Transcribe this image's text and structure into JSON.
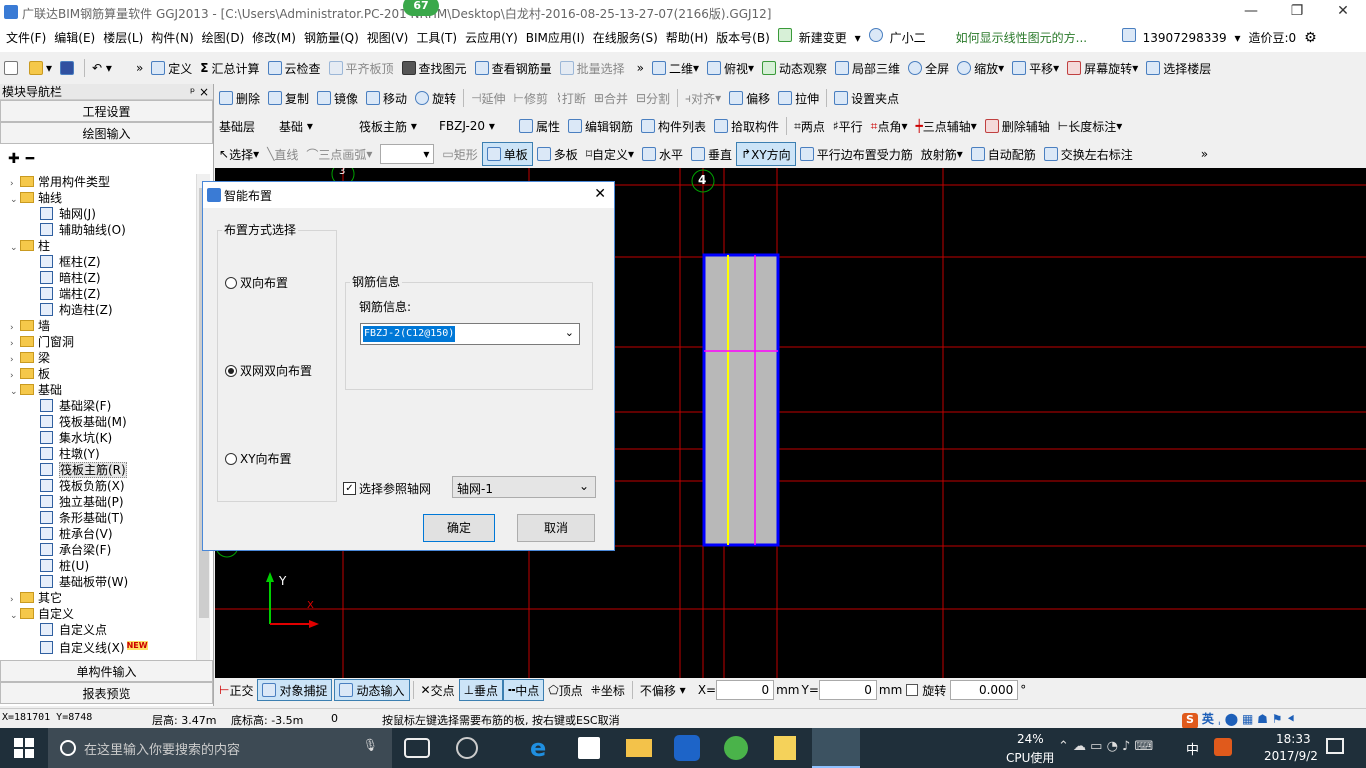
{
  "window": {
    "title": "广联达BIM钢筋算量软件 GGJ2013 - [C:\\Users\\Administrator.PC-201     NRHM\\Desktop\\白龙村-2016-08-25-13-27-07(2166版).GGJ12]",
    "badge": "67",
    "min": "—",
    "restore": "❐",
    "close": "✕"
  },
  "menu": [
    "文件(F)",
    "编辑(E)",
    "楼层(L)",
    "构件(N)",
    "绘图(D)",
    "修改(M)",
    "钢筋量(Q)",
    "视图(V)",
    "工具(T)",
    "云应用(Y)",
    "BIM应用(I)",
    "在线服务(S)",
    "帮助(H)",
    "版本号(B)",
    "新建变更",
    "广小二",
    "如何显示线性图元的方...",
    "13907298339",
    "造价豆:0"
  ],
  "toolbar1": [
    "定义",
    "汇总计算",
    "云检查",
    "平齐板顶",
    "查找图元",
    "查看钢筋量",
    "批量选择",
    "二维",
    "俯视",
    "动态观察",
    "局部三维",
    "全屏",
    "缩放",
    "平移",
    "屏幕旋转",
    "选择楼层"
  ],
  "toolbar2": [
    "删除",
    "复制",
    "镜像",
    "移动",
    "旋转",
    "延伸",
    "修剪",
    "打断",
    "合并",
    "分割",
    "对齐",
    "偏移",
    "拉伸",
    "设置夹点"
  ],
  "toolbar3": [
    "基础层",
    "基础",
    "筏板主筋",
    "FBZJ-20",
    "属性",
    "编辑钢筋",
    "构件列表",
    "拾取构件",
    "两点",
    "平行",
    "点角",
    "三点辅轴",
    "删除辅轴",
    "长度标注"
  ],
  "toolbar4": [
    "选择",
    "直线",
    "三点画弧",
    "矩形",
    "单板",
    "多板",
    "自定义",
    "水平",
    "垂直",
    "XY方向",
    "平行边布置受力筋",
    "放射筋",
    "自动配筋",
    "交换左右标注"
  ],
  "nav": {
    "header": "模块导航栏",
    "pin": "ᵖ ×",
    "project": "工程设置",
    "draw": "绘图输入",
    "single": "单构件输入",
    "report": "报表预览"
  },
  "tree": [
    {
      "label": "常用构件类型",
      "kind": "folder",
      "exp": "›",
      "level": 0
    },
    {
      "label": "轴线",
      "kind": "folder",
      "exp": "⌄",
      "level": 0
    },
    {
      "label": "轴网(J)",
      "kind": "item",
      "level": 1
    },
    {
      "label": "辅助轴线(O)",
      "kind": "item",
      "level": 1
    },
    {
      "label": "柱",
      "kind": "folder",
      "exp": "⌄",
      "level": 0
    },
    {
      "label": "框柱(Z)",
      "kind": "item",
      "level": 1
    },
    {
      "label": "暗柱(Z)",
      "kind": "item",
      "level": 1
    },
    {
      "label": "端柱(Z)",
      "kind": "item",
      "level": 1
    },
    {
      "label": "构造柱(Z)",
      "kind": "item",
      "level": 1
    },
    {
      "label": "墙",
      "kind": "folder",
      "exp": "›",
      "level": 0
    },
    {
      "label": "门窗洞",
      "kind": "folder",
      "exp": "›",
      "level": 0
    },
    {
      "label": "梁",
      "kind": "folder",
      "exp": "›",
      "level": 0
    },
    {
      "label": "板",
      "kind": "folder",
      "exp": "›",
      "level": 0
    },
    {
      "label": "基础",
      "kind": "folder",
      "exp": "⌄",
      "level": 0
    },
    {
      "label": "基础梁(F)",
      "kind": "item",
      "level": 1
    },
    {
      "label": "筏板基础(M)",
      "kind": "item",
      "level": 1
    },
    {
      "label": "集水坑(K)",
      "kind": "item",
      "level": 1
    },
    {
      "label": "柱墩(Y)",
      "kind": "item",
      "level": 1
    },
    {
      "label": "筏板主筋(R)",
      "kind": "item",
      "level": 1,
      "selected": true
    },
    {
      "label": "筏板负筋(X)",
      "kind": "item",
      "level": 1
    },
    {
      "label": "独立基础(P)",
      "kind": "item",
      "level": 1
    },
    {
      "label": "条形基础(T)",
      "kind": "item",
      "level": 1
    },
    {
      "label": "桩承台(V)",
      "kind": "item",
      "level": 1
    },
    {
      "label": "承台梁(F)",
      "kind": "item",
      "level": 1
    },
    {
      "label": "桩(U)",
      "kind": "item",
      "level": 1
    },
    {
      "label": "基础板带(W)",
      "kind": "item",
      "level": 1
    },
    {
      "label": "其它",
      "kind": "folder",
      "exp": "›",
      "level": 0
    },
    {
      "label": "自定义",
      "kind": "folder",
      "exp": "⌄",
      "level": 0
    },
    {
      "label": "自定义点",
      "kind": "item",
      "level": 1
    },
    {
      "label": "自定义线(X)",
      "kind": "item",
      "level": 1,
      "tag": "NEW"
    }
  ],
  "canvas": {
    "axis4": "4",
    "axis3": "3",
    "ylabel": "Y",
    "xlabel": "X"
  },
  "dialog": {
    "title": "智能布置",
    "close": "✕",
    "group_mode": "布置方式选择",
    "opt1": "双向布置",
    "opt2": "双网双向布置",
    "opt3": "XY向布置",
    "group_rebar": "钢筋信息",
    "rebar_label": "钢筋信息:",
    "rebar_value": "FBZJ-2(C12@150)",
    "chk_label": "选择参照轴网",
    "axis_value": "轴网-1",
    "ok": "确定",
    "cancel": "取消"
  },
  "bottom": {
    "items": [
      "正交",
      "对象捕捉",
      "动态输入",
      "交点",
      "垂点",
      "中点",
      "顶点",
      "坐标"
    ],
    "offset": "不偏移",
    "x_label": "X=",
    "x_val": "0",
    "unit1": "mm",
    "y_label": "Y=",
    "y_val": "0",
    "unit2": "mm",
    "rotate": "旋转",
    "rot_val": "0.000",
    "deg": "°"
  },
  "status": {
    "coords": "X=181701 Y=8748",
    "floor_h": "层高: 3.47m",
    "base_h": "底标高: -3.5m",
    "zero": "0",
    "hint": "按鼠标左键选择需要布筋的板, 按右键或ESC取消",
    "ime": "英"
  },
  "taskbar": {
    "search": "在这里输入你要搜索的内容",
    "cpu_pct": "24%",
    "cpu": "CPU使用",
    "lang": "中",
    "time": "18:33",
    "date": "2017/9/2"
  },
  "colors": {
    "canvas": "#000000",
    "grid": "#c00000",
    "slab": "#b8b8b8",
    "border": "#0000ff",
    "yellow": "#ffff00",
    "magenta": "#ff00ff"
  }
}
